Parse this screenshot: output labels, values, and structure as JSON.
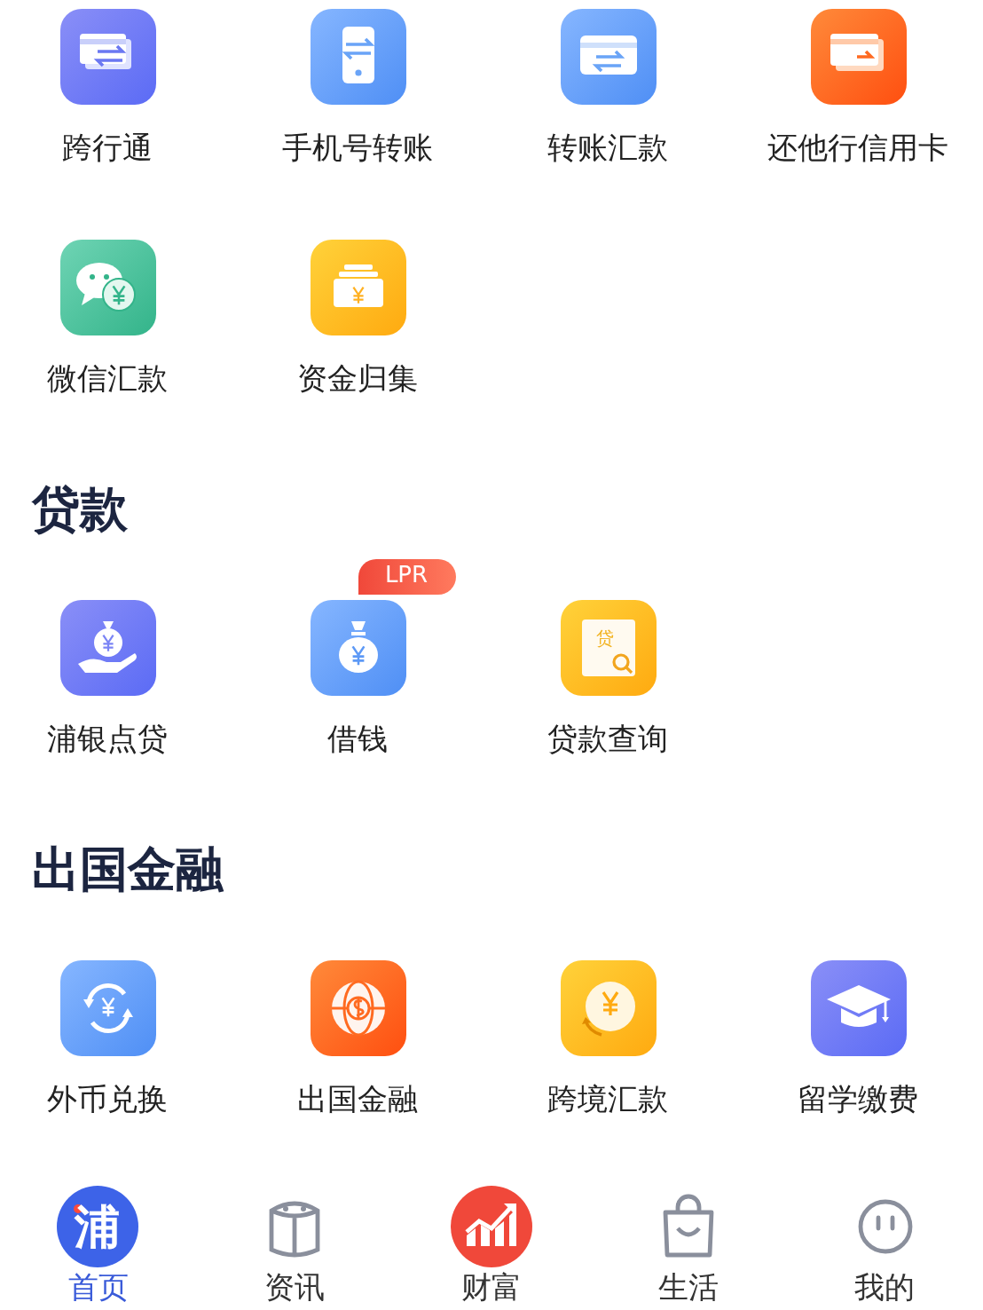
{
  "sections": [
    {
      "items": [
        {
          "label": "跨行通",
          "kind": "cards-transfer"
        },
        {
          "label": "手机号转账",
          "kind": "phone-transfer"
        },
        {
          "label": "转账汇款",
          "kind": "card-transfer"
        },
        {
          "label": "还他行信用卡",
          "kind": "card-repay"
        },
        {
          "label": "微信汇款",
          "kind": "chat-money"
        },
        {
          "label": "资金归集",
          "kind": "money-stack"
        }
      ]
    },
    {
      "title": "贷款",
      "items": [
        {
          "label": "浦银点贷",
          "kind": "bag-hand"
        },
        {
          "label": "借钱",
          "kind": "money-bag",
          "badge": "LPR"
        },
        {
          "label": "贷款查询",
          "kind": "loan-search",
          "icon_text": "贷"
        }
      ]
    },
    {
      "title": "出国金融",
      "items": [
        {
          "label": "外币兑换",
          "kind": "exchange"
        },
        {
          "label": "出国金融",
          "kind": "globe"
        },
        {
          "label": "跨境汇款",
          "kind": "coin"
        },
        {
          "label": "留学缴费",
          "kind": "cap"
        }
      ]
    }
  ],
  "tab_bar": [
    {
      "label": "首页",
      "kind": "home",
      "icon_text": "浦",
      "selected": true
    },
    {
      "label": "资讯",
      "kind": "news",
      "selected": false
    },
    {
      "label": "财富",
      "kind": "wealth",
      "selected": false
    },
    {
      "label": "生活",
      "kind": "life",
      "selected": false
    },
    {
      "label": "我的",
      "kind": "me",
      "selected": false
    }
  ]
}
